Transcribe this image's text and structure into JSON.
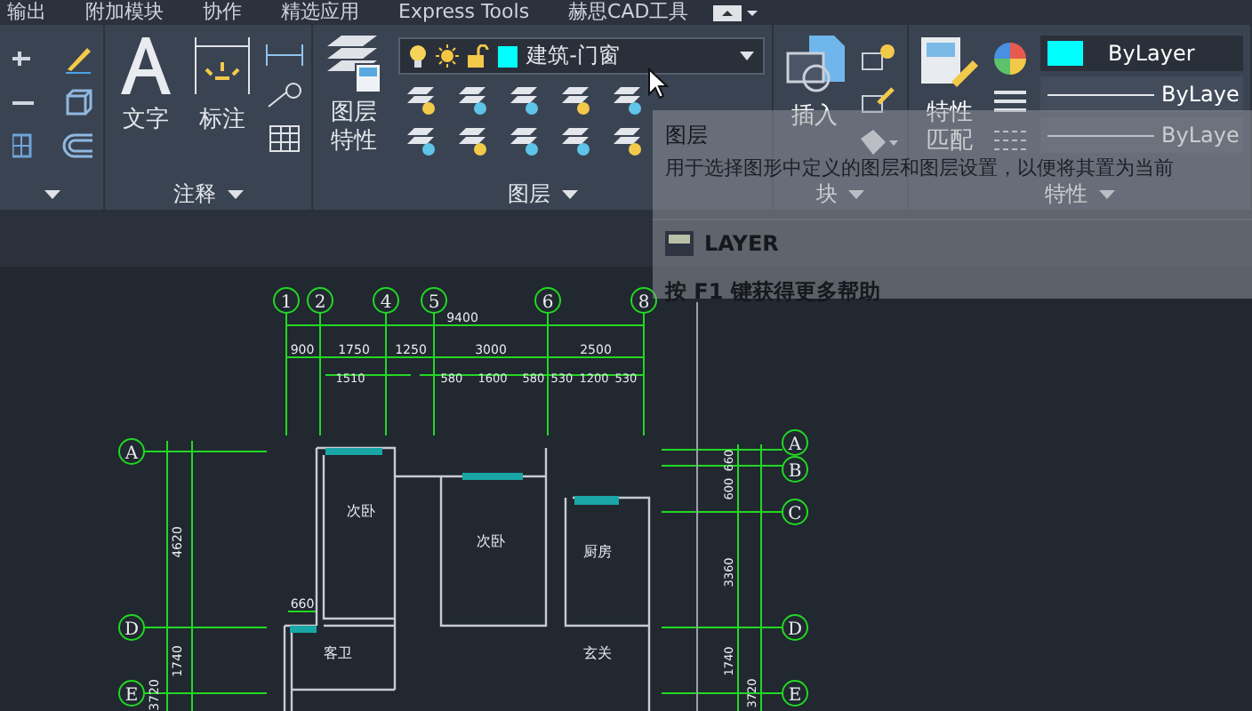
{
  "menu_tabs": [
    "输出",
    "附加模块",
    "协作",
    "精选应用",
    "Express Tools",
    "赫思CAD工具"
  ],
  "ribbon": {
    "annotation": {
      "buttons": [
        "文字",
        "标注"
      ],
      "label": "注释"
    },
    "layers": {
      "button": "图层特性",
      "current_layer": {
        "name": "建筑-门窗",
        "color": "#00ffff"
      },
      "label": "图层"
    },
    "block": {
      "button": "插入",
      "label": "块"
    },
    "properties": {
      "button": "特性匹配",
      "color": {
        "value": "ByLayer",
        "color": "#00ffff"
      },
      "linetype": "ByLaye",
      "lineweight": "ByLaye",
      "label": "特性"
    }
  },
  "tooltip": {
    "title": "图层",
    "description": "用于选择图形中定义的图层和图层设置，以便将其置为当前",
    "command": "LAYER",
    "help": "按 F1 键获得更多帮助"
  },
  "drawing": {
    "top_axes": [
      "1",
      "2",
      "4",
      "5",
      "6",
      "8"
    ],
    "left_axes": [
      "A",
      "D",
      "E"
    ],
    "right_axes": [
      "A",
      "B",
      "C",
      "D",
      "E"
    ],
    "overall_dimension": "9400",
    "axis_dimensions": [
      "900",
      "1750",
      "1250",
      "3000",
      "2500"
    ],
    "opening_dimensions": [
      "1510",
      "580",
      "1600",
      "580",
      "530",
      "1200",
      "530"
    ],
    "left_dimensions": [
      "4620",
      "1740",
      "3720"
    ],
    "right_dimensions": [
      "600",
      "660",
      "3360",
      "1740",
      "3720"
    ],
    "window_dimension": "660",
    "rooms": [
      "次卧",
      "次卧",
      "厨房",
      "客卫",
      "玄关"
    ]
  }
}
